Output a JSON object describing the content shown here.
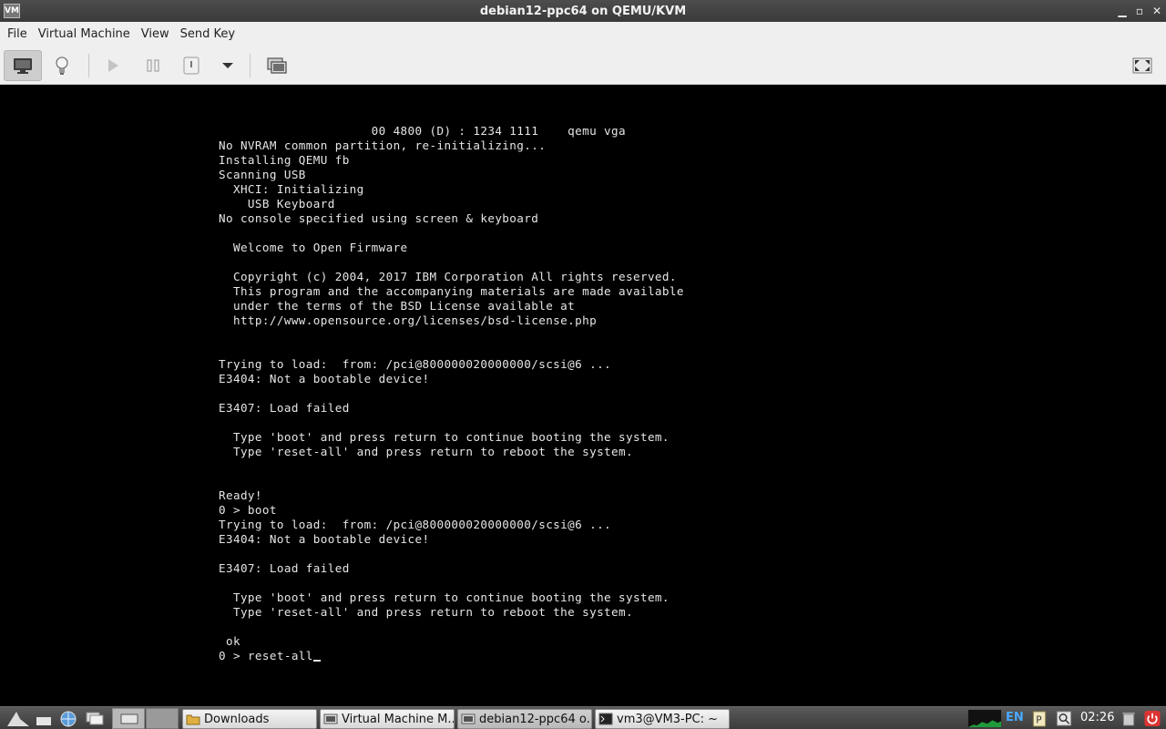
{
  "window": {
    "title": "debian12-ppc64 on QEMU/KVM",
    "app_icon_text": "VM",
    "minimize": "▁",
    "maximize": "▫",
    "close": "✕"
  },
  "menu": [
    "File",
    "Virtual Machine",
    "View",
    "Send Key"
  ],
  "console": {
    "lines": [
      "                     00 4800 (D) : 1234 1111    qemu vga",
      "No NVRAM common partition, re-initializing...",
      "Installing QEMU fb",
      "Scanning USB",
      "  XHCI: Initializing",
      "    USB Keyboard",
      "No console specified using screen & keyboard",
      "",
      "  Welcome to Open Firmware",
      "",
      "  Copyright (c) 2004, 2017 IBM Corporation All rights reserved.",
      "  This program and the accompanying materials are made available",
      "  under the terms of the BSD License available at",
      "  http://www.opensource.org/licenses/bsd-license.php",
      "",
      "",
      "Trying to load:  from: /pci@800000020000000/scsi@6 ...",
      "E3404: Not a bootable device!",
      "",
      "E3407: Load failed",
      "",
      "  Type 'boot' and press return to continue booting the system.",
      "  Type 'reset-all' and press return to reboot the system.",
      "",
      "",
      "Ready!",
      "0 > boot",
      "Trying to load:  from: /pci@800000020000000/scsi@6 ...",
      "E3404: Not a bootable device!",
      "",
      "E3407: Load failed",
      "",
      "  Type 'boot' and press return to continue booting the system.",
      "  Type 'reset-all' and press return to reboot the system.",
      "",
      " ok"
    ],
    "prompt": "0 > reset-all"
  },
  "taskbar": {
    "tasks": [
      "Downloads",
      "Virtual Machine M...",
      "debian12-ppc64 o...",
      "vm3@VM3-PC: ~"
    ],
    "lang": "EN",
    "clock": "02:26"
  }
}
